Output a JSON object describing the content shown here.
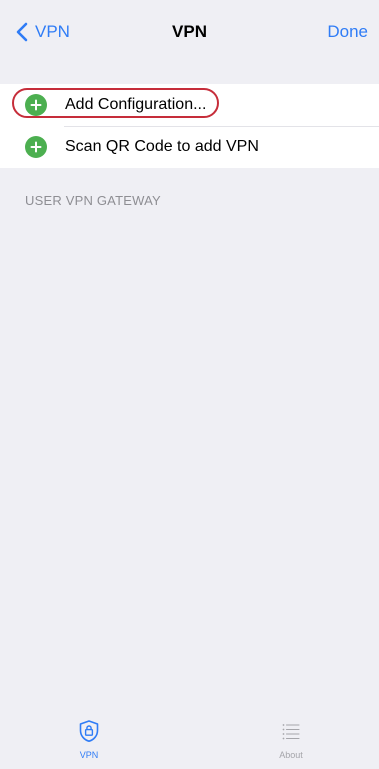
{
  "nav": {
    "back_label": "VPN",
    "title": "VPN",
    "done_label": "Done"
  },
  "list": {
    "items": [
      {
        "label": "Add Configuration...",
        "icon": "plus-circle-icon",
        "highlighted": true
      },
      {
        "label": "Scan QR Code to add VPN",
        "icon": "plus-circle-icon",
        "highlighted": false
      }
    ]
  },
  "section": {
    "header": "USER VPN GATEWAY"
  },
  "tabbar": {
    "tabs": [
      {
        "label": "VPN",
        "icon": "shield-lock-icon",
        "active": true
      },
      {
        "label": "About",
        "icon": "list-icon",
        "active": false
      }
    ]
  },
  "colors": {
    "accent": "#2f7cf6",
    "add_icon": "#4caf50",
    "highlight_ring": "#c62d3a",
    "background": "#efeff4"
  }
}
